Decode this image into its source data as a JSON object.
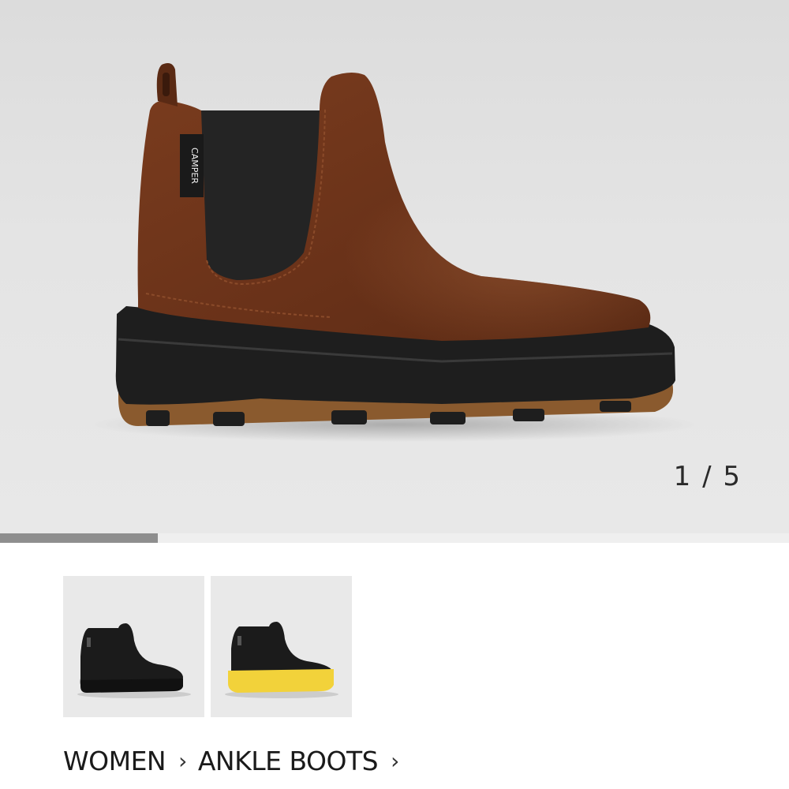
{
  "gallery": {
    "counter": "1 / 5",
    "progress_fraction": 0.2,
    "main_image": "brown-leather-chelsea-ankle-boot",
    "thumbnails": [
      {
        "name": "black-chelsea-boot-thumbnail",
        "upper_color": "#1b1b1b",
        "sole_color": "#1b1b1b"
      },
      {
        "name": "black-yellow-sole-boot-thumbnail",
        "upper_color": "#1b1b1b",
        "sole_color": "#f2d23a"
      }
    ]
  },
  "boot_label": "CAMPER",
  "breadcrumb": {
    "items": [
      "WOMEN",
      "ANKLE BOOTS"
    ],
    "separator_icon": "chevron-right-icon"
  },
  "colors": {
    "leather": "#6b3419",
    "sole": "#1e1e1e",
    "outsole": "#8a5a2e",
    "progress": "#8e8e8e"
  }
}
